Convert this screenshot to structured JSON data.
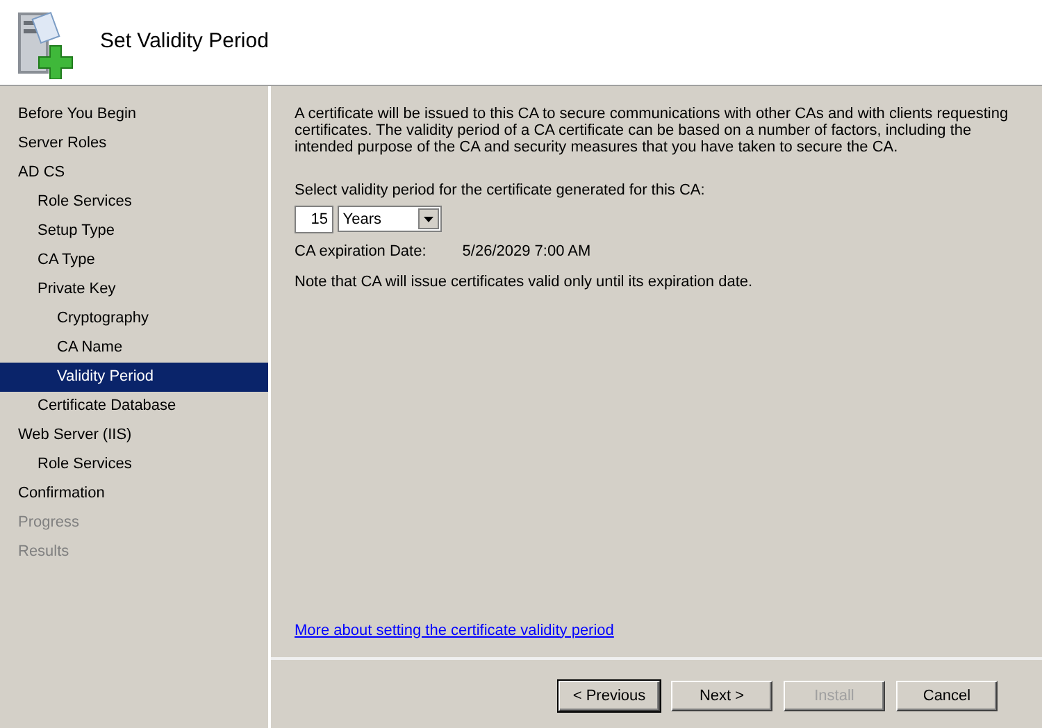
{
  "window": {
    "title": "Set Validity Period"
  },
  "sidebar": {
    "items": [
      {
        "label": "Before You Begin",
        "selected": false,
        "disabled": false
      },
      {
        "label": "Server Roles",
        "selected": false,
        "disabled": false
      },
      {
        "label": "AD CS",
        "selected": false,
        "disabled": false,
        "children": [
          {
            "label": "Role Services",
            "selected": false,
            "disabled": false
          },
          {
            "label": "Setup Type",
            "selected": false,
            "disabled": false
          },
          {
            "label": "CA Type",
            "selected": false,
            "disabled": false
          },
          {
            "label": "Private Key",
            "selected": false,
            "disabled": false,
            "children": [
              {
                "label": "Cryptography",
                "selected": false,
                "disabled": false
              },
              {
                "label": "CA Name",
                "selected": false,
                "disabled": false
              },
              {
                "label": "Validity Period",
                "selected": true,
                "disabled": false
              }
            ]
          },
          {
            "label": "Certificate Database",
            "selected": false,
            "disabled": false
          }
        ]
      },
      {
        "label": "Web Server (IIS)",
        "selected": false,
        "disabled": false,
        "children": [
          {
            "label": "Role Services",
            "selected": false,
            "disabled": false
          }
        ]
      },
      {
        "label": "Confirmation",
        "selected": false,
        "disabled": false
      },
      {
        "label": "Progress",
        "selected": false,
        "disabled": true
      },
      {
        "label": "Results",
        "selected": false,
        "disabled": true
      }
    ]
  },
  "content": {
    "intro": "A certificate will be issued to this CA to secure communications with other CAs and with clients requesting certificates. The validity period of a CA certificate can be based on a number of factors, including the intended purpose of the CA and security measures that you have taken to secure the CA.",
    "period_label": "Select validity period for the certificate generated for this CA:",
    "period_value": "15",
    "period_unit": "Years",
    "expiration_label": "CA expiration Date:",
    "expiration_value": "5/26/2029 7:00 AM",
    "note": "Note that CA will issue certificates valid only until its expiration date.",
    "help_link": "More about setting the certificate validity period"
  },
  "buttons": [
    {
      "label": "< Previous",
      "default": true,
      "disabled": false
    },
    {
      "label": "Next >",
      "default": false,
      "disabled": false
    },
    {
      "label": "Install",
      "default": false,
      "disabled": true
    },
    {
      "label": "Cancel",
      "default": false,
      "disabled": false
    }
  ]
}
